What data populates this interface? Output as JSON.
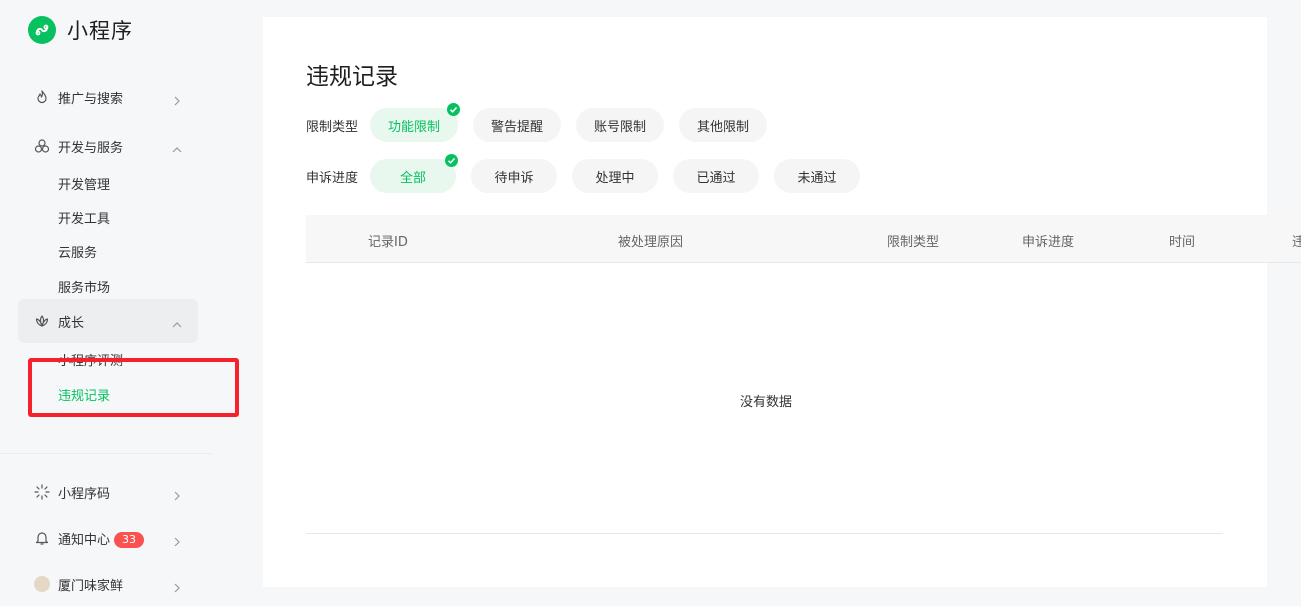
{
  "app": {
    "title": "小程序",
    "colors": {
      "accent": "#07c160",
      "badge": "#fa5151",
      "highlight": "#f5212d"
    }
  },
  "sidebar": {
    "items": [
      {
        "label": "推广与搜索",
        "icon": "flame-icon",
        "expanded": false
      },
      {
        "label": "开发与服务",
        "icon": "cluster-icon",
        "expanded": true,
        "children": [
          "开发管理",
          "开发工具",
          "云服务",
          "服务市场"
        ]
      },
      {
        "label": "成长",
        "icon": "lotus-icon",
        "expanded": true,
        "active": true,
        "children": [
          "小程序评测",
          "违规记录"
        ]
      }
    ],
    "current_child": "违规记录",
    "bottom": [
      {
        "label": "小程序码",
        "icon": "sun-icon"
      },
      {
        "label": "通知中心",
        "icon": "bell-icon",
        "badge": "33"
      },
      {
        "label": "厦门味家鲜",
        "icon": "avatar"
      }
    ]
  },
  "main": {
    "title": "违规记录",
    "filters": {
      "type": {
        "label": "限制类型",
        "options": [
          "功能限制",
          "警告提醒",
          "账号限制",
          "其他限制"
        ],
        "selected": "功能限制"
      },
      "progress": {
        "label": "申诉进度",
        "options": [
          "全部",
          "待申诉",
          "处理中",
          "已通过",
          "未通过"
        ],
        "selected": "全部"
      }
    },
    "table": {
      "columns": [
        "记录ID",
        "被处理原因",
        "限制类型",
        "申诉进度",
        "时间",
        "违"
      ],
      "empty_text": "没有数据"
    }
  }
}
